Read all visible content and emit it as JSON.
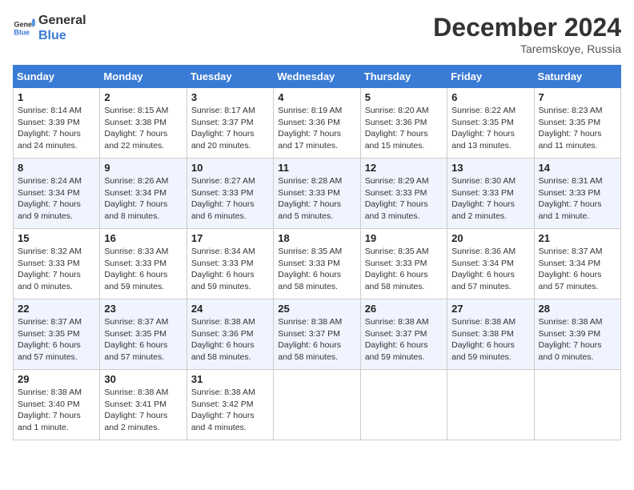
{
  "header": {
    "logo_general": "General",
    "logo_blue": "Blue",
    "month": "December 2024",
    "location": "Taremskoye, Russia"
  },
  "weekdays": [
    "Sunday",
    "Monday",
    "Tuesday",
    "Wednesday",
    "Thursday",
    "Friday",
    "Saturday"
  ],
  "weeks": [
    [
      {
        "day": "1",
        "sunrise": "Sunrise: 8:14 AM",
        "sunset": "Sunset: 3:39 PM",
        "daylight": "Daylight: 7 hours and 24 minutes."
      },
      {
        "day": "2",
        "sunrise": "Sunrise: 8:15 AM",
        "sunset": "Sunset: 3:38 PM",
        "daylight": "Daylight: 7 hours and 22 minutes."
      },
      {
        "day": "3",
        "sunrise": "Sunrise: 8:17 AM",
        "sunset": "Sunset: 3:37 PM",
        "daylight": "Daylight: 7 hours and 20 minutes."
      },
      {
        "day": "4",
        "sunrise": "Sunrise: 8:19 AM",
        "sunset": "Sunset: 3:36 PM",
        "daylight": "Daylight: 7 hours and 17 minutes."
      },
      {
        "day": "5",
        "sunrise": "Sunrise: 8:20 AM",
        "sunset": "Sunset: 3:36 PM",
        "daylight": "Daylight: 7 hours and 15 minutes."
      },
      {
        "day": "6",
        "sunrise": "Sunrise: 8:22 AM",
        "sunset": "Sunset: 3:35 PM",
        "daylight": "Daylight: 7 hours and 13 minutes."
      },
      {
        "day": "7",
        "sunrise": "Sunrise: 8:23 AM",
        "sunset": "Sunset: 3:35 PM",
        "daylight": "Daylight: 7 hours and 11 minutes."
      }
    ],
    [
      {
        "day": "8",
        "sunrise": "Sunrise: 8:24 AM",
        "sunset": "Sunset: 3:34 PM",
        "daylight": "Daylight: 7 hours and 9 minutes."
      },
      {
        "day": "9",
        "sunrise": "Sunrise: 8:26 AM",
        "sunset": "Sunset: 3:34 PM",
        "daylight": "Daylight: 7 hours and 8 minutes."
      },
      {
        "day": "10",
        "sunrise": "Sunrise: 8:27 AM",
        "sunset": "Sunset: 3:33 PM",
        "daylight": "Daylight: 7 hours and 6 minutes."
      },
      {
        "day": "11",
        "sunrise": "Sunrise: 8:28 AM",
        "sunset": "Sunset: 3:33 PM",
        "daylight": "Daylight: 7 hours and 5 minutes."
      },
      {
        "day": "12",
        "sunrise": "Sunrise: 8:29 AM",
        "sunset": "Sunset: 3:33 PM",
        "daylight": "Daylight: 7 hours and 3 minutes."
      },
      {
        "day": "13",
        "sunrise": "Sunrise: 8:30 AM",
        "sunset": "Sunset: 3:33 PM",
        "daylight": "Daylight: 7 hours and 2 minutes."
      },
      {
        "day": "14",
        "sunrise": "Sunrise: 8:31 AM",
        "sunset": "Sunset: 3:33 PM",
        "daylight": "Daylight: 7 hours and 1 minute."
      }
    ],
    [
      {
        "day": "15",
        "sunrise": "Sunrise: 8:32 AM",
        "sunset": "Sunset: 3:33 PM",
        "daylight": "Daylight: 7 hours and 0 minutes."
      },
      {
        "day": "16",
        "sunrise": "Sunrise: 8:33 AM",
        "sunset": "Sunset: 3:33 PM",
        "daylight": "Daylight: 6 hours and 59 minutes."
      },
      {
        "day": "17",
        "sunrise": "Sunrise: 8:34 AM",
        "sunset": "Sunset: 3:33 PM",
        "daylight": "Daylight: 6 hours and 59 minutes."
      },
      {
        "day": "18",
        "sunrise": "Sunrise: 8:35 AM",
        "sunset": "Sunset: 3:33 PM",
        "daylight": "Daylight: 6 hours and 58 minutes."
      },
      {
        "day": "19",
        "sunrise": "Sunrise: 8:35 AM",
        "sunset": "Sunset: 3:33 PM",
        "daylight": "Daylight: 6 hours and 58 minutes."
      },
      {
        "day": "20",
        "sunrise": "Sunrise: 8:36 AM",
        "sunset": "Sunset: 3:34 PM",
        "daylight": "Daylight: 6 hours and 57 minutes."
      },
      {
        "day": "21",
        "sunrise": "Sunrise: 8:37 AM",
        "sunset": "Sunset: 3:34 PM",
        "daylight": "Daylight: 6 hours and 57 minutes."
      }
    ],
    [
      {
        "day": "22",
        "sunrise": "Sunrise: 8:37 AM",
        "sunset": "Sunset: 3:35 PM",
        "daylight": "Daylight: 6 hours and 57 minutes."
      },
      {
        "day": "23",
        "sunrise": "Sunrise: 8:37 AM",
        "sunset": "Sunset: 3:35 PM",
        "daylight": "Daylight: 6 hours and 57 minutes."
      },
      {
        "day": "24",
        "sunrise": "Sunrise: 8:38 AM",
        "sunset": "Sunset: 3:36 PM",
        "daylight": "Daylight: 6 hours and 58 minutes."
      },
      {
        "day": "25",
        "sunrise": "Sunrise: 8:38 AM",
        "sunset": "Sunset: 3:37 PM",
        "daylight": "Daylight: 6 hours and 58 minutes."
      },
      {
        "day": "26",
        "sunrise": "Sunrise: 8:38 AM",
        "sunset": "Sunset: 3:37 PM",
        "daylight": "Daylight: 6 hours and 59 minutes."
      },
      {
        "day": "27",
        "sunrise": "Sunrise: 8:38 AM",
        "sunset": "Sunset: 3:38 PM",
        "daylight": "Daylight: 6 hours and 59 minutes."
      },
      {
        "day": "28",
        "sunrise": "Sunrise: 8:38 AM",
        "sunset": "Sunset: 3:39 PM",
        "daylight": "Daylight: 7 hours and 0 minutes."
      }
    ],
    [
      {
        "day": "29",
        "sunrise": "Sunrise: 8:38 AM",
        "sunset": "Sunset: 3:40 PM",
        "daylight": "Daylight: 7 hours and 1 minute."
      },
      {
        "day": "30",
        "sunrise": "Sunrise: 8:38 AM",
        "sunset": "Sunset: 3:41 PM",
        "daylight": "Daylight: 7 hours and 2 minutes."
      },
      {
        "day": "31",
        "sunrise": "Sunrise: 8:38 AM",
        "sunset": "Sunset: 3:42 PM",
        "daylight": "Daylight: 7 hours and 4 minutes."
      },
      null,
      null,
      null,
      null
    ]
  ]
}
